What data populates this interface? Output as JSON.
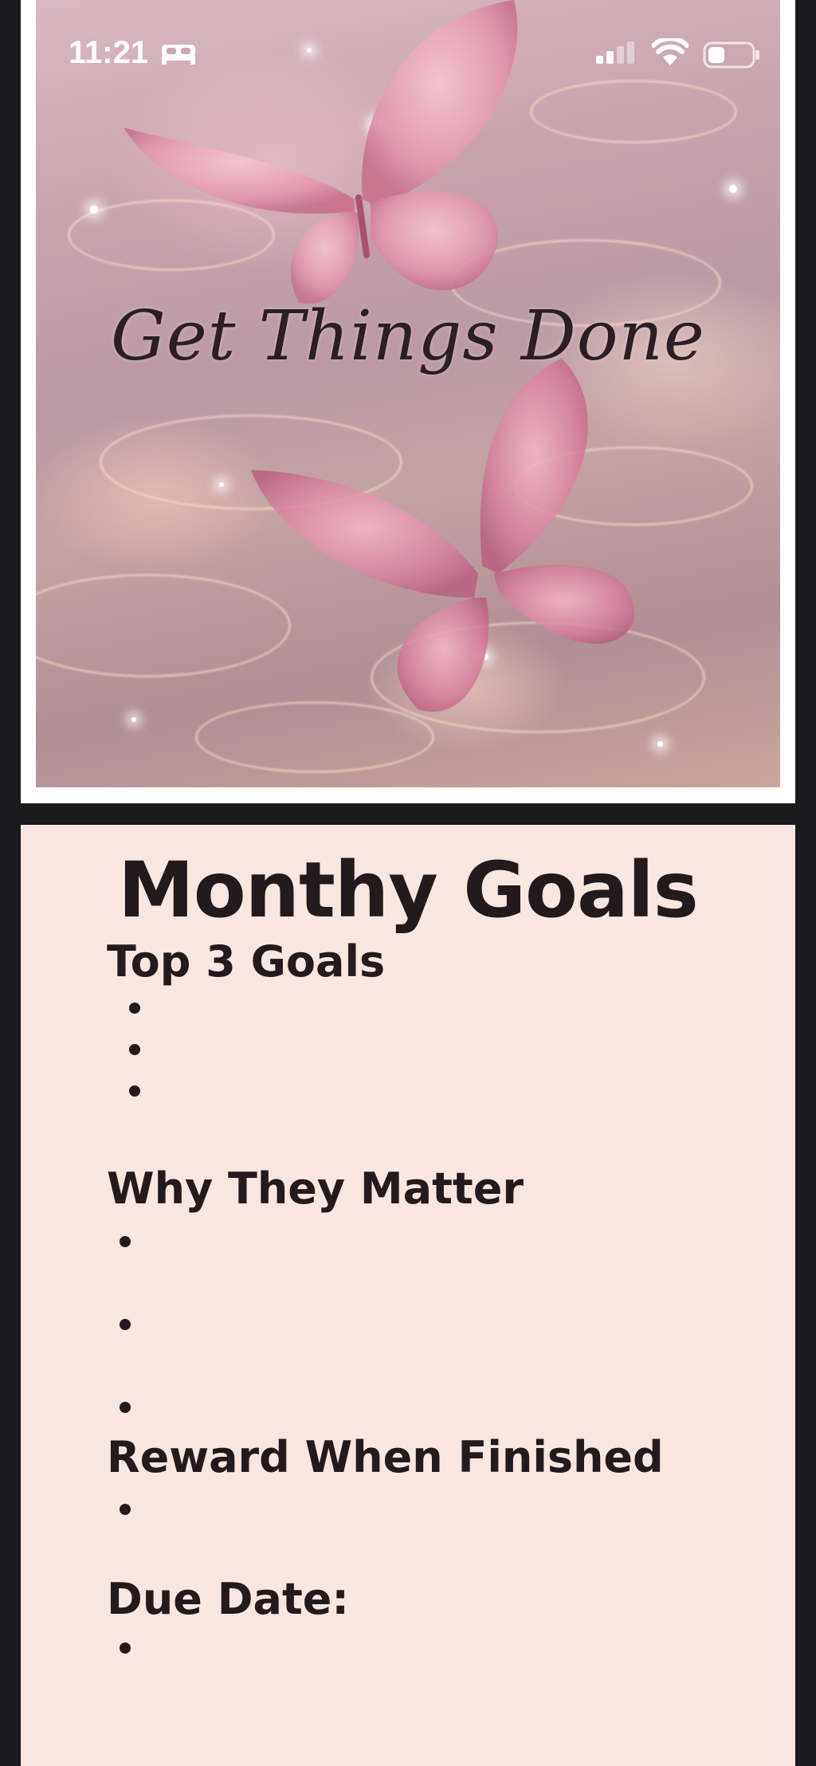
{
  "status_bar": {
    "time": "11:21",
    "icons": [
      "sleep-focus-icon",
      "cellular-signal-icon",
      "wifi-icon",
      "battery-icon"
    ]
  },
  "hero": {
    "title": "Get Things Done",
    "image": "pink-butterflies-over-sparkling-water"
  },
  "goals": {
    "title": "Monthy Goals",
    "sections": [
      {
        "heading": "Top 3 Goals",
        "bullet_count": 3
      },
      {
        "heading": "Why They Matter",
        "bullet_count": 3
      },
      {
        "heading": "Reward When Finished",
        "bullet_count": 1
      },
      {
        "heading": "Due Date:",
        "bullet_count": 1
      }
    ]
  },
  "colors": {
    "page_background": "#1c1b1d",
    "card_background": "#f8e6e0",
    "text": "#231a1d",
    "frame": "#ffffff"
  }
}
